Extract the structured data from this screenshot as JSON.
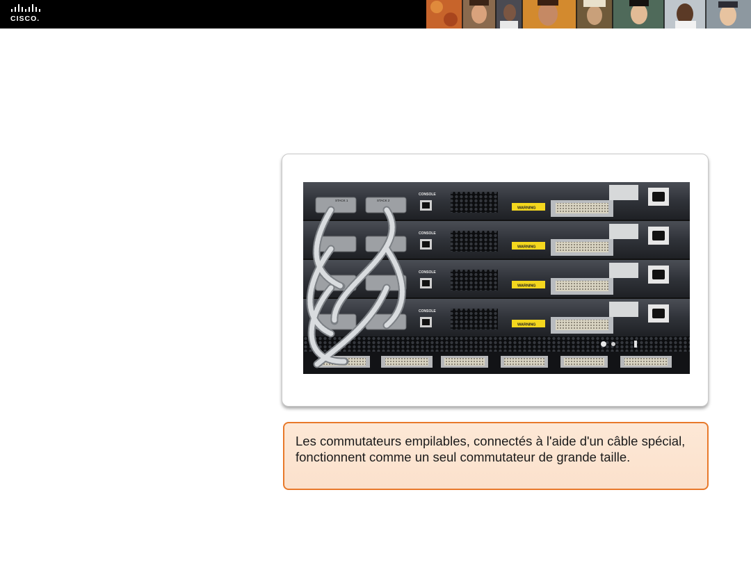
{
  "header": {
    "logo_text": "CISCO.",
    "photo_strip_icon": "people-photo-strip"
  },
  "slide": {
    "image_icon": "stacked-switches-photo",
    "image_labels": {
      "console": "CONSOLE",
      "warning": "WARNING",
      "stack_1": "STACK 1",
      "stack_2": "STACK 2"
    },
    "caption": "Les commutateurs empilables, connectés à l'aide d'un câble spécial, fonctionnent comme un seul commutateur de grande taille."
  },
  "colors": {
    "header_bg": "#000000",
    "caption_border": "#e8792a",
    "caption_bg": "#fde8d6"
  }
}
